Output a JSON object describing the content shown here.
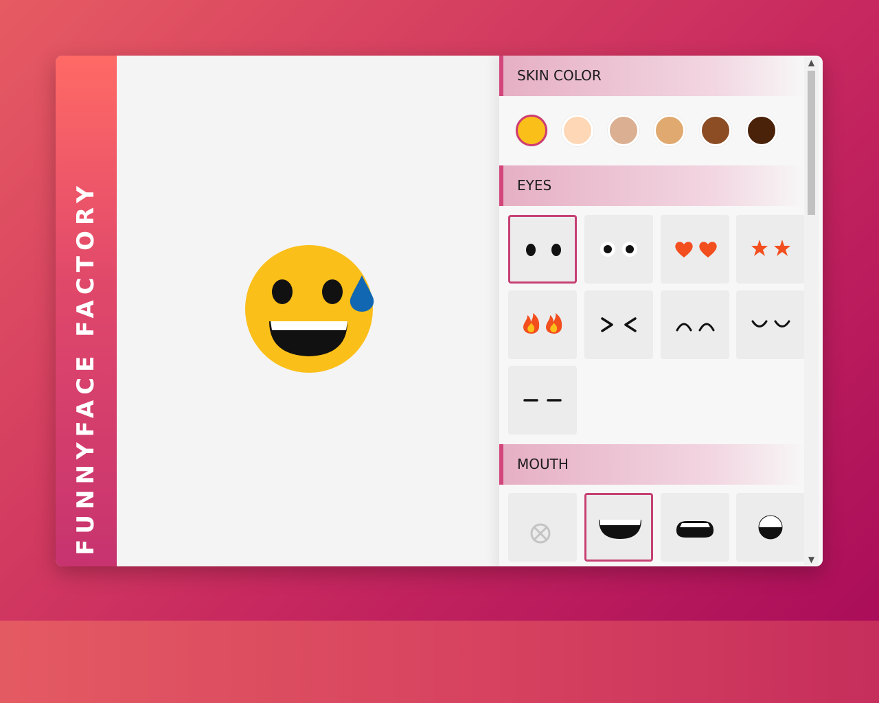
{
  "brand": {
    "title": "FUNNYFACE FACTORY"
  },
  "sections": {
    "skin_color": {
      "label": "SKIN COLOR"
    },
    "eyes": {
      "label": "EYES"
    },
    "mouth": {
      "label": "MOUTH"
    }
  },
  "skin_colors": [
    "#fbbf1a",
    "#fdd7b6",
    "#dbb092",
    "#dfa96f",
    "#8c4c24",
    "#4a2209"
  ],
  "selected_skin_color": "#fbbf1a",
  "eye_options": [
    "dots-eyes",
    "white-dot-eyes",
    "heart-eyes",
    "star-eyes",
    "fire-eyes",
    "squint-eyes",
    "arc-eyes",
    "closed-eyes",
    "dash-eyes"
  ],
  "selected_eyes": "dots-eyes",
  "mouth_options": [
    "no-mouth",
    "big-grin-mouth",
    "rounded-mouth",
    "half-circle-mouth"
  ],
  "selected_mouth": "big-grin-mouth",
  "face": {
    "skin": "#fbbf1a",
    "sweat_drop": "#1167b1"
  },
  "colors": {
    "accent": "#d2457a",
    "eye_red": "#f24e1e"
  }
}
